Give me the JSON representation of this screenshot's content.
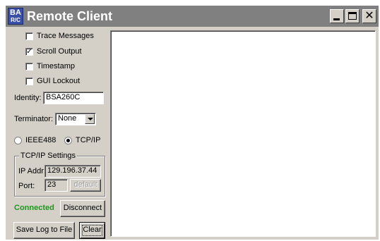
{
  "window": {
    "title": "Remote Client",
    "icon_top": "BA",
    "icon_bottom": "R/C",
    "minimize_icon": "minimize-icon",
    "maximize_icon": "maximize-icon",
    "close_glyph": "✕"
  },
  "options": {
    "trace_messages": {
      "label": "Trace Messages",
      "checked": false
    },
    "scroll_output": {
      "label": "Scroll Output",
      "checked": true
    },
    "timestamp": {
      "label": "Timestamp",
      "checked": false
    },
    "gui_lockout": {
      "label": "GUI Lockout",
      "checked": false
    },
    "check_mark": "✓"
  },
  "identity": {
    "label": "Identity:",
    "value": "BSA260C"
  },
  "terminator": {
    "label": "Terminator:",
    "value": "None"
  },
  "interface": {
    "ieee488_label": "IEEE488",
    "tcpip_label": "TCP/IP",
    "selected": "TCP/IP"
  },
  "tcpip_settings": {
    "group_title": "TCP/IP Settings",
    "ip_label": "IP Addr:",
    "ip_value": "129.196.37.44",
    "port_label": "Port:",
    "port_value": "23",
    "default_label": "default"
  },
  "status": {
    "text": "Connected",
    "color": "#1a9a1a"
  },
  "buttons": {
    "disconnect": "Disconnect",
    "save_log": "Save Log to File",
    "clear": "Clear"
  },
  "colors": {
    "titlebar": "#808080",
    "window_bg": "#d4d0c8",
    "app_icon_bg": "#3a4fa8"
  }
}
